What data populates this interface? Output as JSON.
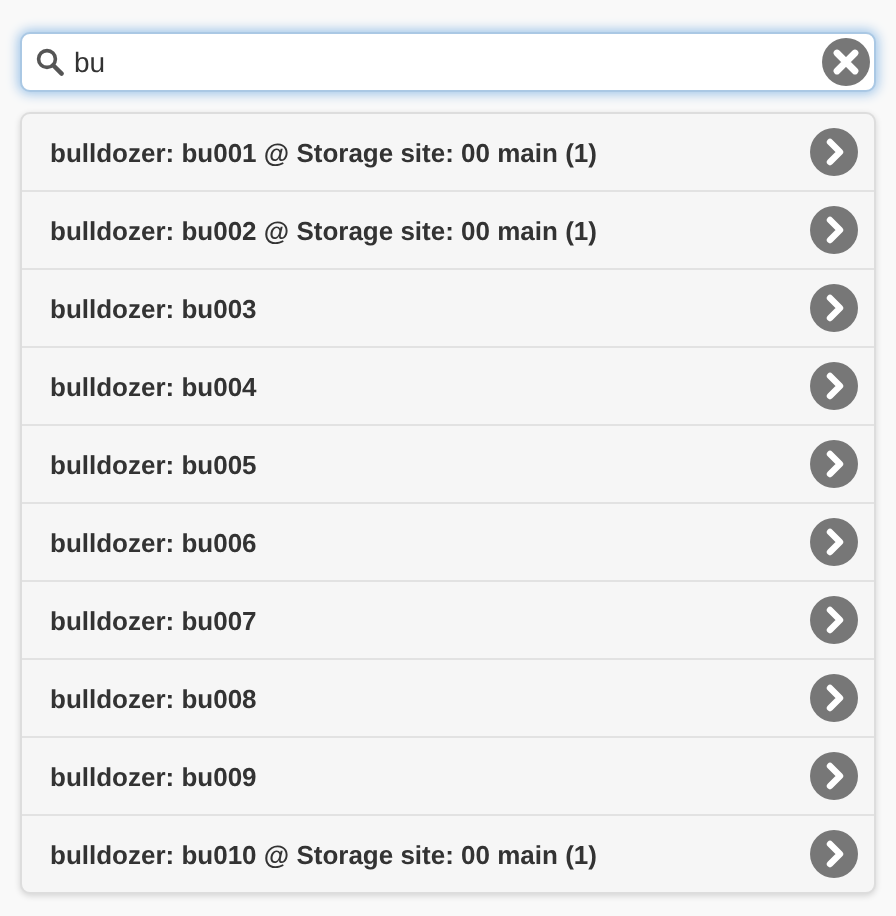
{
  "search": {
    "value": "bu"
  },
  "results": [
    {
      "label": "bulldozer: bu001 @ Storage site: 00 main (1)"
    },
    {
      "label": "bulldozer: bu002 @ Storage site: 00 main (1)"
    },
    {
      "label": "bulldozer: bu003"
    },
    {
      "label": "bulldozer: bu004"
    },
    {
      "label": "bulldozer: bu005"
    },
    {
      "label": "bulldozer: bu006"
    },
    {
      "label": "bulldozer: bu007"
    },
    {
      "label": "bulldozer: bu008"
    },
    {
      "label": "bulldozer: bu009"
    },
    {
      "label": "bulldozer: bu010 @ Storage site: 00 main (1)"
    }
  ]
}
